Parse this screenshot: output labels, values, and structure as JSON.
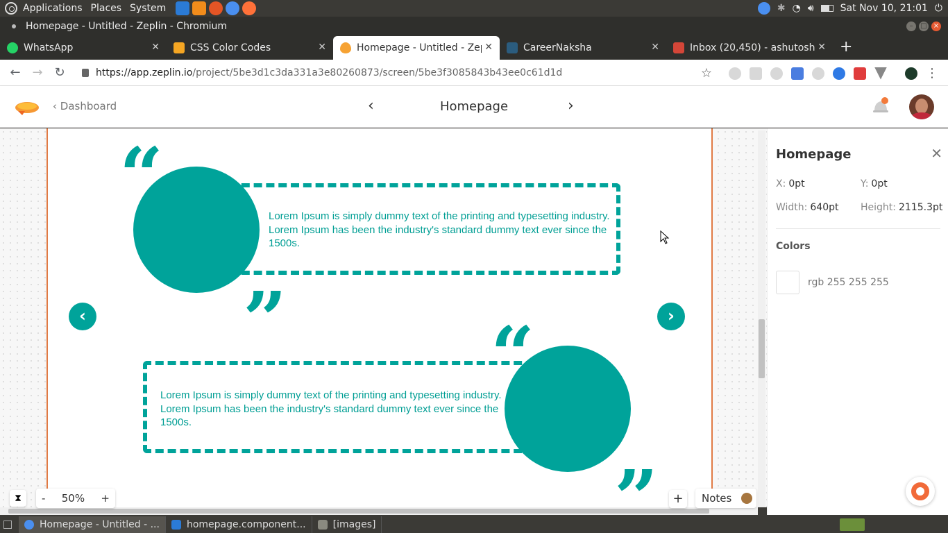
{
  "system_panel": {
    "menus": [
      "Applications",
      "Places",
      "System"
    ],
    "clock": "Sat Nov 10, 21:01"
  },
  "window": {
    "title": "Homepage - Untitled - Zeplin - Chromium"
  },
  "tabs": [
    {
      "label": "WhatsApp",
      "active": false,
      "color": "#25d366"
    },
    {
      "label": "CSS Color Codes",
      "active": false,
      "color": "#f5a623"
    },
    {
      "label": "Homepage - Untitled - Zeplin",
      "active": true,
      "color": "#f6a233"
    },
    {
      "label": "CareerNaksha",
      "active": false,
      "color": "#2b5c7e"
    },
    {
      "label": "Inbox (20,450) - ashutosh",
      "active": false,
      "color": "#d44638"
    }
  ],
  "address": {
    "host": "https://app.zeplin.io",
    "path": "/project/5be3d1c3da331a3e80260873/screen/5be3f3085843b43ee0c61d1d"
  },
  "header": {
    "back_label": "Dashboard",
    "screen_title": "Homepage"
  },
  "testimonials": [
    {
      "text": "Lorem Ipsum is simply dummy text of the printing and typesetting industry. Lorem Ipsum has been the industry's standard dummy text ever since the 1500s."
    },
    {
      "text": "Lorem Ipsum is simply dummy text of the printing and typesetting industry. Lorem Ipsum has been the industry's standard dummy text ever since the 1500s."
    }
  ],
  "quote_open": "“",
  "quote_close": "”",
  "carousel": {
    "prev": "‹",
    "next": "›"
  },
  "panel": {
    "title": "Homepage",
    "x_label": "X:",
    "x_value": "0pt",
    "y_label": "Y:",
    "y_value": "0pt",
    "width_label": "Width:",
    "width_value": "640pt",
    "height_label": "Height:",
    "height_value": "2115.3pt",
    "colors_heading": "Colors",
    "swatch_label": "rgb 255 255 255"
  },
  "zoom": {
    "minus": "-",
    "value": "50%",
    "plus": "+"
  },
  "notes_label": "Notes",
  "taskbar": [
    {
      "label": "Homepage - Untitled - ..."
    },
    {
      "label": "homepage.component..."
    },
    {
      "label": "[images]"
    }
  ],
  "colors": {
    "accent": "#00a39a",
    "artboard_border": "#e07a44"
  }
}
